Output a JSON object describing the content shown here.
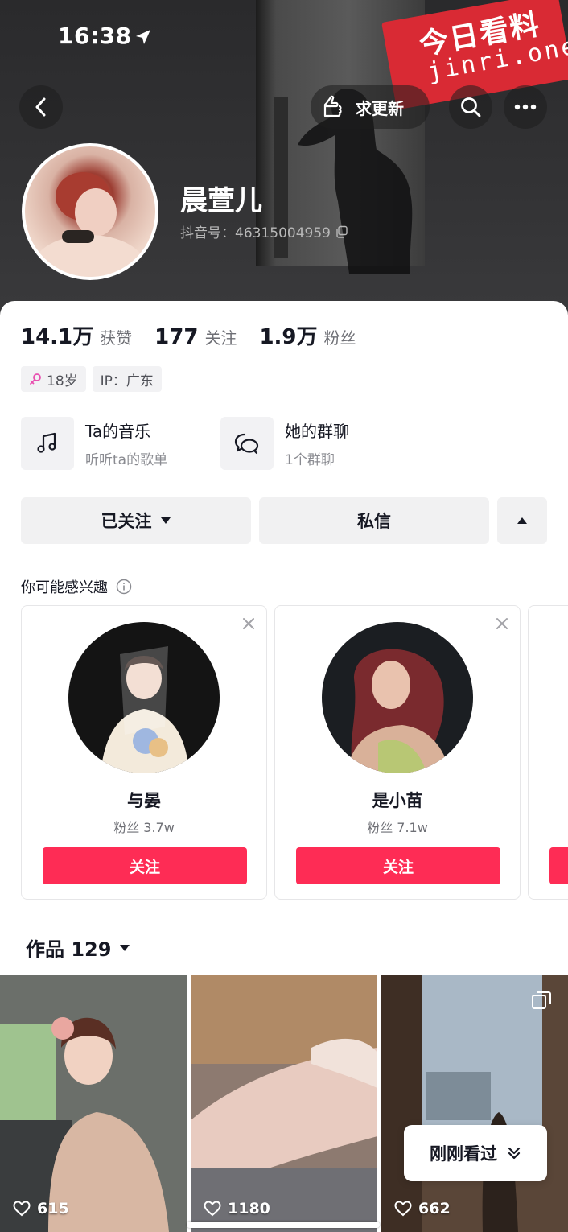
{
  "status_bar": {
    "time": "16:38"
  },
  "watermark": {
    "line1": "今日看料",
    "line2": "jinri.one"
  },
  "header": {
    "update_label": "求更新"
  },
  "profile": {
    "name": "晨萱儿",
    "douyin_id": "抖音号：46315004959"
  },
  "stats": [
    {
      "value": "14.1万",
      "label": "获赞"
    },
    {
      "value": "177",
      "label": "关注"
    },
    {
      "value": "1.9万",
      "label": "粉丝"
    }
  ],
  "tags": {
    "age": "18岁",
    "ip": "IP：广东"
  },
  "features": [
    {
      "title": "Ta的音乐",
      "subtitle": "听听ta的歌单"
    },
    {
      "title": "她的群聊",
      "subtitle": "1个群聊"
    }
  ],
  "actions": {
    "followed": "已关注",
    "message": "私信"
  },
  "suggestions": {
    "title": "你可能感兴趣",
    "cards": [
      {
        "name": "与晏",
        "fans": "粉丝 3.7w",
        "follow": "关注"
      },
      {
        "name": "是小苗",
        "fans": "粉丝 7.1w",
        "follow": "关注"
      }
    ]
  },
  "works": {
    "header": "作品 129",
    "items": [
      {
        "likes": "615"
      },
      {
        "likes": "1180"
      },
      {
        "likes": "662"
      }
    ],
    "recent_label": "刚刚看过"
  },
  "colors": {
    "accent": "#fe2c55",
    "header_bg": "#2f2f31"
  }
}
